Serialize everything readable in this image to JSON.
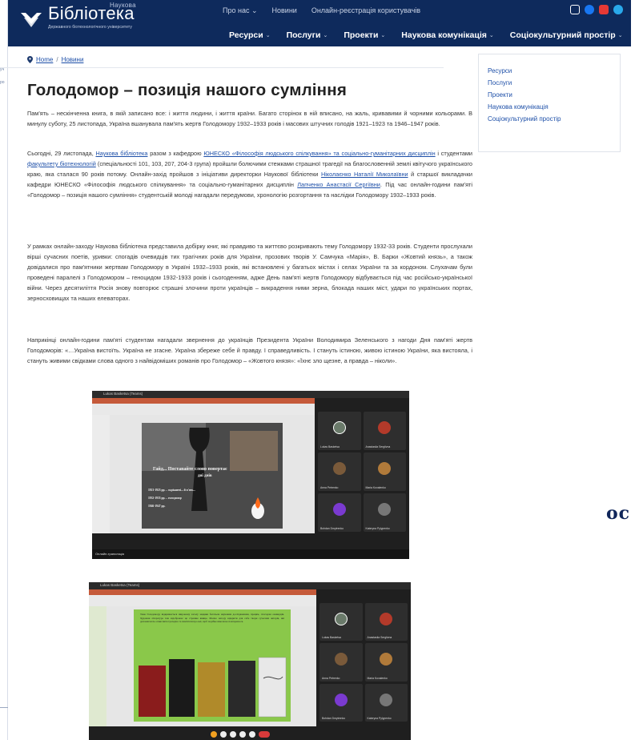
{
  "left_strip": {
    "hints": [
      "уч",
      "ро"
    ]
  },
  "header": {
    "logo_top": "Наукова",
    "logo_text": "Бібліотека",
    "logo_sub": "Державного біотехнологічного університету",
    "top_nav": [
      "Про нас ⌄",
      "Новини",
      "Онлайн-реєстрація користувачів"
    ],
    "main_nav": [
      {
        "label": "Ресурси"
      },
      {
        "label": "Послуги"
      },
      {
        "label": "Проекти"
      },
      {
        "label": "Наукова комунікація"
      },
      {
        "label": "Соціокультурний простір"
      }
    ],
    "social_colors": [
      "#ffffff",
      "#1877f2",
      "#e53935",
      "#29a9eb"
    ]
  },
  "breadcrumb": {
    "home": "Home",
    "sep": "/",
    "current": "Новини"
  },
  "title": "Голодомор – позиція нашого сумління",
  "paragraphs": {
    "p1": "Пам'ять – нескінченна книга, в якій записано все: і життя людини, і життя країни. Багато сторінок в ній вписано, на жаль, кривавими й чорними кольорами. В минулу суботу, 25 листопада, Україна вшанувала пам'ять жертв Голодомору 1932–1933 років і масових штучних голодів 1921–1923 та 1946–1947 років.",
    "p2a": "Сьогодні, 29 листопада, ",
    "p2_link1": "Наукова бібліотека",
    "p2b": " разом з кафедрою ",
    "p2_link2": "ЮНЕСКО «Філософія людського спілкування» та соціально-гуманітарних дисциплін",
    "p2c": " і студентами ",
    "p2_link3": "факультету біотехнологій",
    "p2d": " (спеціальності 101, 103, 207, 204-3 група) пройшли болючими стежками страшної трагедії на благословенній землі квітучого українського краю, яка сталася 90 років потому. Онлайн-захід пройшов з ініціативи директорки Наукової бібліотеки ",
    "p2_link4": "Ніколаєнко Наталії Миколаївни",
    "p2e": " й старшої викладачки кафедри ЮНЕСКО «Філософія людського спілкування» та соціально-гуманітарних дисциплін ",
    "p2_link5": "Лапченко Анастасії Сергіївни",
    "p2f": ". Під час онлайн-години пам'яті «Голодомор – позиція нашого сумління» студентській молоді нагадали передумови, хронологію розгортання та наслідки Голодомору 1932–1933 років.",
    "p3": "У рамках онлайн-заходу Наукова бібліотека представила добірку книг, які правдиво та життєво розкривають тему Голодомору 1932-33 років. Студенти прослухали вірші сучасних поетів, уривки: спогадів очевидців тих трагічних років для України, прозових творів У. Самчука «Марія», В. Барки «Жовтий князь», а також довідалися про пам'ятники жертвам Голодомору в Україні 1932–1933 років, які встановлені у багатьох містах і селах України та за кордоном. Слухачам були проведені паралелі з Голодомором – геноцидом 1932-1933 років і сьогоденням, адже День пам'яті жертв Голодомору відбувається під час російсько-української війни. Через десятиліття Росія знову повторює страшні злочини проти українців – викрадення ними зерна, блокада наших міст, удари по українських портах, зерносховищах та наших елеваторах.",
    "p4": "Наприкінці онлайн-години пам'яті студентам нагадали звернення до українців Президента України Володимира Зеленського з нагоди Дня пам'яті жертв Голодоморів: «…Україна вистоїть. Україна не згасне. Україна збереже себе й правду. І справедливість. І стануть істиною, живою істиною України, яка вистояла, і стануть живими свідками слова одного з найвідоміших романів про Голодомор – «Жовтого князя»: «Їхнє зло щезне, а правда – ніколи»."
  },
  "sidebar": [
    "Ресурси",
    "Послуги",
    "Проекти",
    "Наукова комунікація",
    "Соціокультурний простір"
  ],
  "screenshot1": {
    "window_title": "Lukas Basketsa (Teams)",
    "slide_lines": [
      "Гайд... Поставайте слово повертає",
      "дні днів",
      "1921-1923 рр. – скрікаючі... й п'ять...",
      "1932-1933 рр. – голодомор",
      "1946-1947 рр."
    ],
    "participants": [
      "Lukas Basketsa",
      "Anastasiia Sergiivna",
      "Anna Petrenko",
      "Maria Kovalenko",
      "Bohdan Dmytrenko",
      "Kateryna Pylypenko"
    ],
    "tile_colors": [
      "#6a7a6a",
      "#b33a2a",
      "#7a5a3a",
      "#b07a3a",
      "#7a3ad0",
      "#777777"
    ],
    "taskbar_label": "Онлайн-трансляція"
  },
  "screenshot2": {
    "window_title": "Lukas Basketsa (Teams)",
    "slide_text": "Тема Голодомору відкривається широкому загалу завдяки багатьом науковим дослідженням, працям, спогадам очевидців. Художня література теж відображає це страшне явище. Маємо нагоду відкрити для себе твори сучасних авторів, які допомагають осмислити трагедію та пам'ятати про неї, щоб подібне ніколи не повторилося.",
    "participants": [
      "Lukas Basketsa",
      "Anastasiia Sergiivna",
      "Anna Petrenko",
      "Maria Kovalenko",
      "Bohdan Dmytrenko",
      "Kateryna Pylypenko"
    ],
    "tile_colors": [
      "#6a7a6a",
      "#b33a2a",
      "#7a5a3a",
      "#b07a3a",
      "#7a3ad0",
      "#777777"
    ],
    "book_colors": [
      "#8a1c1c",
      "#1a1a1a",
      "#b08a2a",
      "#2a2a2a",
      "#e8e8e8"
    ]
  },
  "right_partial": "ос"
}
